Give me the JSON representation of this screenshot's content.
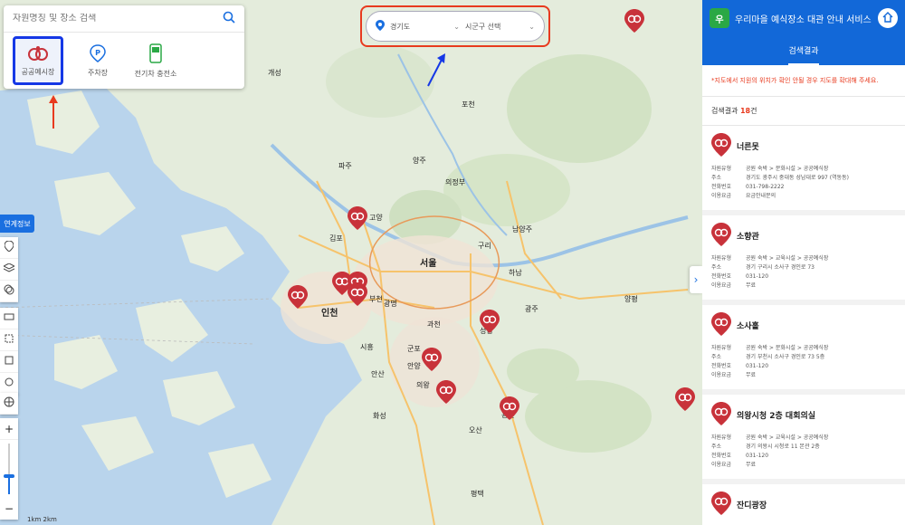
{
  "search": {
    "placeholder": "자원명칭 및 장소 검색"
  },
  "categories": [
    {
      "label": "공공예시장",
      "icon": "public-facility-icon",
      "active": true
    },
    {
      "label": "주차장",
      "icon": "parking-icon",
      "active": false
    },
    {
      "label": "전기차 충전소",
      "icon": "ev-charger-icon",
      "active": false
    }
  ],
  "region": {
    "sido": "경기도",
    "sigungu": "시군구 선택"
  },
  "tools": {
    "info_button": "연계정보"
  },
  "map_labels": {
    "kaesong": "개성",
    "paju": "파주",
    "goyang": "고양",
    "gimpo": "김포",
    "seoul": "서울",
    "incheon": "인천",
    "guri": "구리",
    "namyangju": "남양주",
    "hanam": "하남",
    "seongnam": "성남",
    "anyang": "안양",
    "gwacheon": "과천",
    "yongin": "용인",
    "suwon": "수원",
    "osan": "오산",
    "bucheon": "부천",
    "gwangmyeong": "광명",
    "siheung": "시흥",
    "ansan": "안산",
    "uijeongbu": "의정부",
    "yangju": "양주",
    "pocheon": "포천",
    "yangpyeong": "양평",
    "gwangju": "광주",
    "gunpo": "군포",
    "uiwang": "의왕",
    "hwaseong": "화성",
    "pyeongtaek": "평택"
  },
  "scale": "1km   2km",
  "panel": {
    "title": "우리마을 예식장소 대관 안내 서비스",
    "tab": "검색결과",
    "notice": "*지도에서 지원의 위치가 확인 안될 경우 지도를 확대해 주세요.",
    "count_prefix": "검색결과 ",
    "count_value": "18",
    "count_suffix": "건",
    "items": [
      {
        "name": "너른못",
        "rows": [
          [
            "자원유형",
            "공원 숙박 > 문화시설 > 공공예식장"
          ],
          [
            "주소",
            "경기도 광주시 중대동 성남대로 997 (역동동)"
          ],
          [
            "전화번호",
            "031-798-2222"
          ],
          [
            "이용요금",
            "요금안내문의"
          ]
        ]
      },
      {
        "name": "소향관",
        "rows": [
          [
            "자원유형",
            "공원 숙박 > 교육시설 > 공공예식장"
          ],
          [
            "주소",
            "경기 구리시 소사구 경인로 73"
          ],
          [
            "전화번호",
            "031-120"
          ],
          [
            "이용요금",
            "무료"
          ]
        ]
      },
      {
        "name": "소사홀",
        "rows": [
          [
            "자원유형",
            "공원 숙박 > 문화시설 > 공공예식장"
          ],
          [
            "주소",
            "경기 부천시 소사구 경인로 73 5층"
          ],
          [
            "전화번호",
            "031-120"
          ],
          [
            "이용요금",
            "무료"
          ]
        ]
      },
      {
        "name": "의왕시청 2층 대회의실",
        "rows": [
          [
            "자원유형",
            "공원 숙박 > 교육시설 > 공공예식장"
          ],
          [
            "주소",
            "경기 의왕시 시청로 11 본관 2층"
          ],
          [
            "전화번호",
            "031-120"
          ],
          [
            "이용요금",
            "무료"
          ]
        ]
      },
      {
        "name": "잔디광장",
        "rows": []
      }
    ]
  },
  "colors": {
    "accent": "#1268d8",
    "marker": "#c8323a",
    "highlight_red": "#e83a1e",
    "highlight_blue": "#1538e6"
  }
}
